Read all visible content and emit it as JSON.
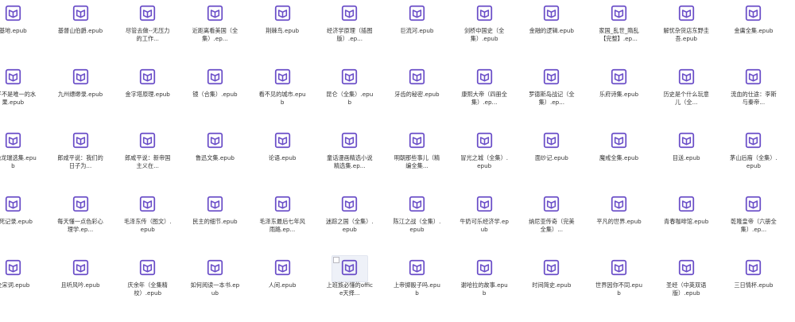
{
  "theme": {
    "icon_color": "#6a4ec8",
    "text_color": "#333333"
  },
  "files": [
    {
      "name": "基地.epub",
      "icon": "book-icon"
    },
    {
      "name": "基督山伯爵.epub",
      "icon": "book-icon"
    },
    {
      "name": "尽管去做--无压力的工作...",
      "icon": "book-icon"
    },
    {
      "name": "近距离看美国（全集）.ep...",
      "icon": "book-icon"
    },
    {
      "name": "荆棘鸟.epub",
      "icon": "book-icon"
    },
    {
      "name": "经济学原理（插图版）.ep...",
      "icon": "book-icon"
    },
    {
      "name": "巨流河.epub",
      "icon": "book-icon"
    },
    {
      "name": "剑桥中国史（全集）.epub",
      "icon": "book-icon"
    },
    {
      "name": "金融的逻辑.epub",
      "icon": "book-icon"
    },
    {
      "name": "家国_乱世_隋乱【完整】.ep...",
      "icon": "book-icon"
    },
    {
      "name": "解忧杂货店东野圭吾.epub",
      "icon": "book-icon"
    },
    {
      "name": "金庸全集.epub",
      "icon": "book-icon"
    },
    {
      "name": "橘子不是唯一的水果.epub",
      "icon": "book-icon"
    },
    {
      "name": "九州缥缈录.epub",
      "icon": "book-icon"
    },
    {
      "name": "金字塔原理.epub",
      "icon": "book-icon"
    },
    {
      "name": "镜（合集）.epub",
      "icon": "book-icon"
    },
    {
      "name": "看不见的城市.epub",
      "icon": "book-icon"
    },
    {
      "name": "昆仑（全集）.epub",
      "icon": "book-icon"
    },
    {
      "name": "牙齿的秘密.epub",
      "icon": "book-icon"
    },
    {
      "name": "康熙大帝（四册全集）.ep...",
      "icon": "book-icon"
    },
    {
      "name": "罗德斯岛战记（全集）.ep...",
      "icon": "book-icon"
    },
    {
      "name": "乐府诗集.epub",
      "icon": "book-icon"
    },
    {
      "name": "历史是个什么玩意儿（全...",
      "icon": "book-icon"
    },
    {
      "name": "流血的仕途：李斯与秦帝...",
      "icon": "book-icon"
    },
    {
      "name": "三隐龙瑞选集.epub",
      "icon": "book-icon"
    },
    {
      "name": "郎咸平说：我们的日子为...",
      "icon": "book-icon"
    },
    {
      "name": "郎咸平说：新帝国主义在...",
      "icon": "book-icon"
    },
    {
      "name": "鲁迅文集.epub",
      "icon": "book-icon"
    },
    {
      "name": "论语.epub",
      "icon": "book-icon"
    },
    {
      "name": "童话漫画精选小说精选集.ep...",
      "icon": "book-icon"
    },
    {
      "name": "明朝那些事儿（精编全集...",
      "icon": "book-icon"
    },
    {
      "name": "冒光之城（全集）.epub",
      "icon": "book-icon"
    },
    {
      "name": "面纱记.epub",
      "icon": "book-icon"
    },
    {
      "name": "魔戒全集.epub",
      "icon": "book-icon"
    },
    {
      "name": "目送.epub",
      "icon": "book-icon"
    },
    {
      "name": "茅山后裔（全集）.epub",
      "icon": "book-icon"
    },
    {
      "name": "冒死记录.epub",
      "icon": "book-icon"
    },
    {
      "name": "每天懂一点色彩心理学.ep...",
      "icon": "book-icon"
    },
    {
      "name": "毛泽东传（图文）.epub",
      "icon": "book-icon"
    },
    {
      "name": "民主的细节.epub",
      "icon": "book-icon"
    },
    {
      "name": "毛泽东最后七年风雨路.ep...",
      "icon": "book-icon"
    },
    {
      "name": "迷踪之国（全集）.epub",
      "icon": "book-icon"
    },
    {
      "name": "陈江之战（全集）.epub",
      "icon": "book-icon"
    },
    {
      "name": "牛奶可乐经济学.epub",
      "icon": "book-icon"
    },
    {
      "name": "纳尼亚传奇（完美全集）...",
      "icon": "book-icon"
    },
    {
      "name": "平凡的世界.epub",
      "icon": "book-icon"
    },
    {
      "name": "青春咖啡馆.epub",
      "icon": "book-icon"
    },
    {
      "name": "乾隆皇帝（六册全集）.ep...",
      "icon": "book-icon"
    },
    {
      "name": "全宋词.epub",
      "icon": "book-icon"
    },
    {
      "name": "且听风吟.epub",
      "icon": "book-icon"
    },
    {
      "name": "庆余年（全集精校）.epub",
      "icon": "book-icon"
    },
    {
      "name": "如何阅读一本书.epub",
      "icon": "book-icon"
    },
    {
      "name": "人间.epub",
      "icon": "book-icon"
    },
    {
      "name": "上班族必懂的office天择...",
      "icon": "book-icon",
      "selected": true
    },
    {
      "name": "上帝掷骰子吗.epub",
      "icon": "book-icon"
    },
    {
      "name": "谢哈拉的故事.epub",
      "icon": "book-icon"
    },
    {
      "name": "时间简史.epub",
      "icon": "book-icon"
    },
    {
      "name": "世界因你不同.epub",
      "icon": "book-icon"
    },
    {
      "name": "圣经（中英双语版）.epub",
      "icon": "book-icon"
    },
    {
      "name": "三日情杯.epub",
      "icon": "book-icon"
    }
  ]
}
